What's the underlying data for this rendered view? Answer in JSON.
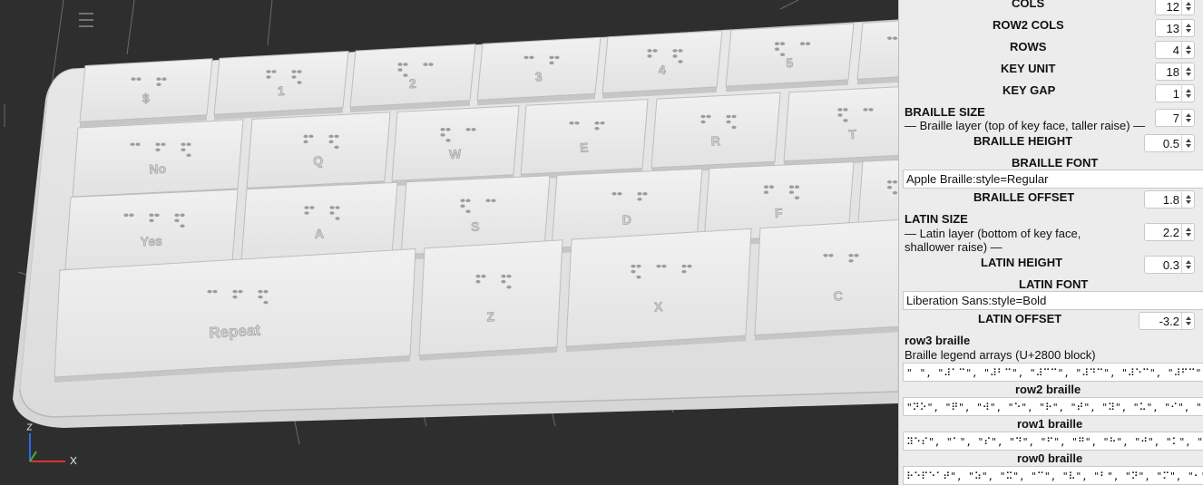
{
  "keyboard": {
    "row3": [
      "$",
      "1",
      "2",
      "3",
      "4",
      "5",
      ""
    ],
    "row2": [
      "No",
      "Q",
      "W",
      "E",
      "R",
      "T"
    ],
    "row1": [
      "Yes",
      "A",
      "S",
      "D",
      "F",
      ""
    ],
    "row0": [
      "Repeat",
      "Z",
      "X",
      "C",
      ""
    ]
  },
  "panel": {
    "cols": {
      "label": "COLS",
      "value": "12"
    },
    "row2_cols": {
      "label": "ROW2 COLS",
      "value": "13"
    },
    "rows": {
      "label": "ROWS",
      "value": "4"
    },
    "key_unit": {
      "label": "KEY UNIT",
      "value": "18"
    },
    "key_gap": {
      "label": "KEY GAP",
      "value": "1"
    },
    "braille_size": {
      "label": "BRAILLE SIZE",
      "value": "7"
    },
    "braille_layer_desc": "— Braille layer (top of key face, taller raise) —",
    "braille_height": {
      "label": "BRAILLE HEIGHT",
      "value": "0.5"
    },
    "braille_font": {
      "label": "BRAILLE FONT",
      "value": "Apple Braille:style=Regular"
    },
    "braille_offset": {
      "label": "BRAILLE OFFSET",
      "value": "1.8"
    },
    "latin_size": {
      "label": "LATIN SIZE",
      "value": "2.2"
    },
    "latin_layer_desc_1": "— Latin layer (bottom of key face,",
    "latin_layer_desc_2": "shallower raise) —",
    "latin_height": {
      "label": "LATIN HEIGHT",
      "value": "0.3"
    },
    "latin_font": {
      "label": "LATIN FONT",
      "value": "Liberation Sans:style=Bold"
    },
    "latin_offset": {
      "label": "LATIN OFFSET",
      "value": "-3.2"
    },
    "row3_braille": {
      "label": "row3 braille",
      "desc": "Braille legend arrays (U+2800 block)",
      "value": "\"⠀\", \"⠼⠁⠉\", \"⠼⠃⠉\", \"⠼⠉⠉\", \"⠼⠙⠉\", \"⠼⠑⠉\", \"⠼⠋⠉\", \"⠼⠛⠉\", \"⠼⠓⠉\", \"⠼⠊⠉\", \"⠼⠚⠉\"]"
    },
    "row2_braille": {
      "label": "row2 braille",
      "value": "\"⠝⠕\", \"⠟\", \"⠺\", \"⠑\", \"⠗\", \"⠞\", \"⠽\", \"⠥\", \"⠊\", \"⠕\", \"⠏\", \"⠔⠉\", \"⠶⠉\"]"
    },
    "row1_braille": {
      "label": "row1 braille",
      "value": "⠽⠑⠎\", \"⠁\", \"⠎\", \"⠙\", \"⠋\", \"⠛\", \"⠓\", \"⠚\", \"⠅\", \"⠇\", \"⠰⠆\", \"⠄⠉\", \"⠠⠉⠝⠞⠗\"]"
    },
    "row0_braille": {
      "label": "row0 braille",
      "value": "⠗⠑⠏⠑⠁⠞\", \"⠵\", \"⠭\", \"⠉\", \"⠧\", \"⠃\", \"⠝\", \"⠍\", \"⠂\", \"⠲\", \"⠌\", \"⠸⠉\"]"
    }
  },
  "colors": {
    "viewport_bg": "#2e2e2e",
    "panel_bg": "#ececec",
    "model": "#e4e4e4"
  }
}
